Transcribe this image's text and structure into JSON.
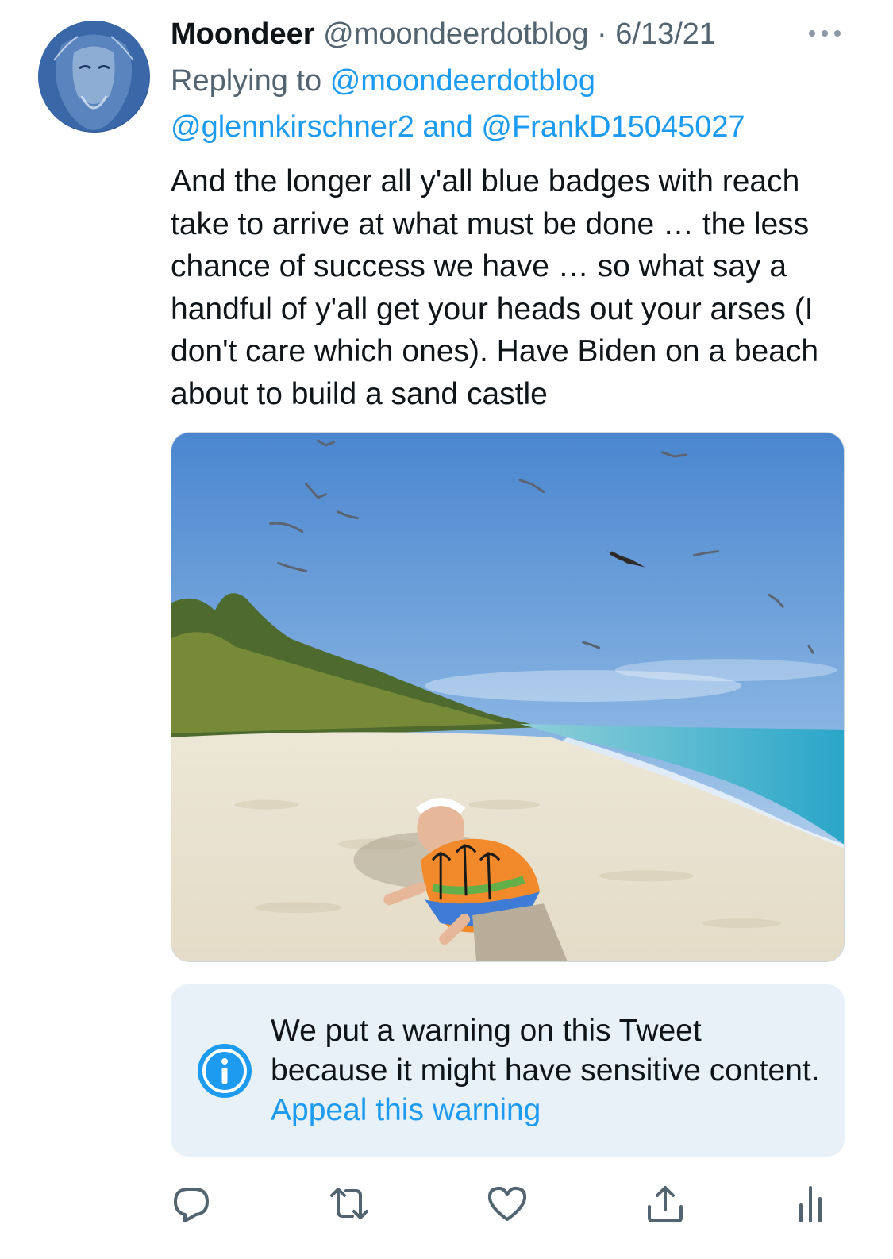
{
  "tweet": {
    "display_name": "Moondeer",
    "handle": "@moondeerdotblog",
    "separator": "·",
    "date": "6/13/21",
    "more_icon": "ellipsis-icon",
    "replying_to_label": "Replying to",
    "replying_to_handle": "@moondeerdotblog",
    "reply_mention_1": "@glennkirschner2",
    "reply_and": "and",
    "reply_mention_2": "@FrankD15045027",
    "text": "And the longer all y'all blue badges with reach take to arrive at what must be done … the less chance of success we have … so what say a handful of y'all get your heads out your arses (I don't care which ones). Have Biden on a beach about to build a sand castle"
  },
  "warning": {
    "icon": "info-icon",
    "message": "We put a warning on this Tweet because it might have sensitive content.",
    "link": "Appeal this warning"
  },
  "actions": [
    {
      "icon": "reply-icon"
    },
    {
      "icon": "retweet-icon"
    },
    {
      "icon": "like-icon"
    },
    {
      "icon": "share-icon"
    },
    {
      "icon": "analytics-icon"
    }
  ],
  "colors": {
    "accent": "#1d9bf0",
    "secondary_text": "#536471",
    "warning_background": "#e8f1f8"
  }
}
